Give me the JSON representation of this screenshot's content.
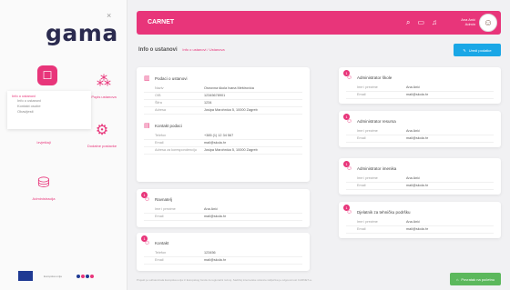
{
  "app": {
    "logo": "gama",
    "close": "×"
  },
  "sidebar": {
    "tiles": [
      {
        "icon": "chat-icon",
        "glyph": "☐",
        "label": "Info o ustanovi"
      },
      {
        "icon": "grid-icon",
        "glyph": "⁂",
        "label": "Popis ustanova"
      },
      {
        "icon": "document-icon",
        "glyph": "▢",
        "label": "Izvještaji"
      },
      {
        "icon": "settings-icon",
        "glyph": "⚙",
        "label": "Dodatne postavke"
      },
      {
        "icon": "layers-icon",
        "glyph": "⛁",
        "label": "Administracija"
      }
    ],
    "submenu": {
      "head": "Info o ustanovi",
      "items": [
        "Info o ustanovi",
        "Kontakt osobe",
        "Obavijesti"
      ]
    },
    "footer_text": "Europska unija"
  },
  "header": {
    "title": "CARNET",
    "user_name": "Ana Anić",
    "user_role": "Admin"
  },
  "page": {
    "breadcrumb": "Info o ustanovi",
    "breadcrumb_sub": "Info o ustanovi / Ustanova",
    "primary_button": "Uredi podatke"
  },
  "left_cards": [
    {
      "sections": [
        {
          "title": "Podaci o ustanovi",
          "rows": [
            {
              "k": "Naziv",
              "v": "Osnovna škola Ivana Meštrovića"
            },
            {
              "k": "OIB",
              "v": "12345678901"
            },
            {
              "k": "Šifra",
              "v": "1234"
            },
            {
              "k": "Adresa",
              "v": "Josipa Marohnića 5, 10000 Zagreb"
            }
          ]
        },
        {
          "title": "Kontakt podaci",
          "rows": [
            {
              "k": "Telefon",
              "v": "+385 (1) 12 34 567"
            },
            {
              "k": "Email",
              "v": "mail@skola.hr"
            },
            {
              "k": "Adresa za korespondenciju",
              "v": "Josipa Marohnića 5, 10000 Zagreb"
            }
          ]
        }
      ]
    },
    {
      "sections": [
        {
          "title": "Ravnatelj",
          "badge": "1",
          "rows": [
            {
              "k": "Ime i prezime",
              "v": "Ana Anić"
            },
            {
              "k": "Email",
              "v": "mail@skola.hr"
            }
          ]
        }
      ]
    },
    {
      "sections": [
        {
          "title": "Kontakt",
          "badge": "1",
          "rows": [
            {
              "k": "Telefon",
              "v": "123456"
            },
            {
              "k": "Email",
              "v": "mail@skola.hr"
            }
          ]
        }
      ]
    }
  ],
  "right_cards": [
    {
      "title": "Administrator škole",
      "badge": "1",
      "rows": [
        {
          "k": "Ime i prezime",
          "v": "Ana Anić"
        },
        {
          "k": "Email",
          "v": "mail@skola.hr"
        }
      ]
    },
    {
      "title": "Administrator resursa",
      "badge": "1",
      "rows": [
        {
          "k": "Ime i prezime",
          "v": "Ana Anić"
        },
        {
          "k": "Email",
          "v": "mail@skola.hr"
        }
      ]
    },
    {
      "title": "Administrator imenika",
      "badge": "1",
      "rows": [
        {
          "k": "Ime i prezime",
          "v": "Ana Anić"
        },
        {
          "k": "Email",
          "v": "mail@skola.hr"
        }
      ]
    },
    {
      "title": "Djelatnik za tehničku podršku",
      "badge": "1",
      "rows": [
        {
          "k": "Ime i prezime",
          "v": "Ana Anić"
        },
        {
          "k": "Email",
          "v": "mail@skola.hr"
        }
      ]
    }
  ],
  "footer": {
    "text": "Projekt je sufinancirala Europska unija iz Europskog fonda za regionalni razvoj. Sadržaj internetske stranice isključiva je odgovornost CARNET-a.",
    "green_button": "Povratak na početnu"
  },
  "colors": {
    "accent": "#e8357a",
    "primary": "#1aa7e6",
    "success": "#5cb85c"
  }
}
